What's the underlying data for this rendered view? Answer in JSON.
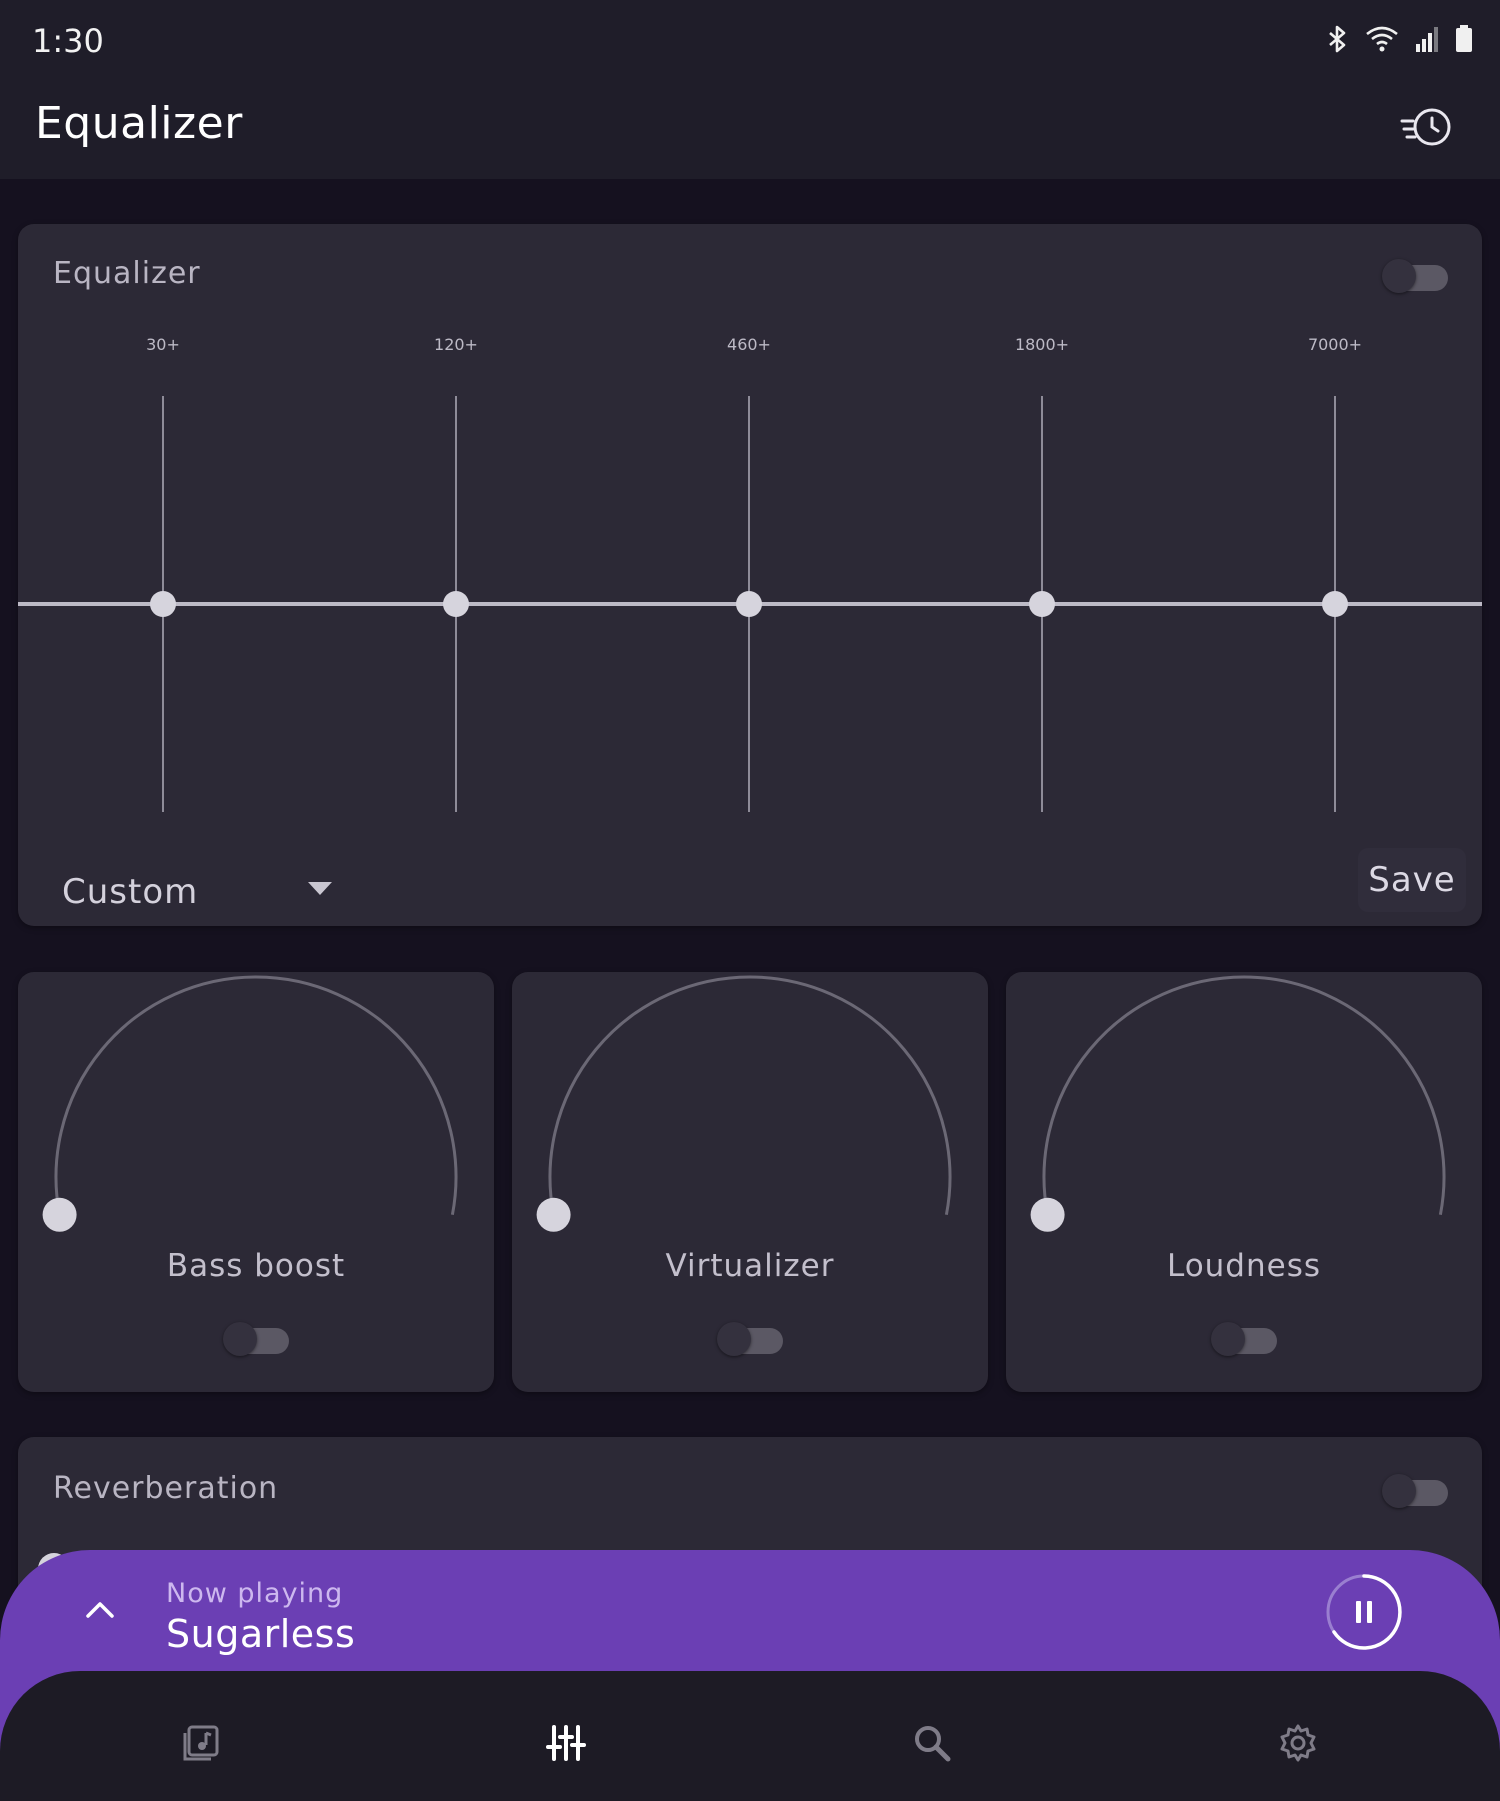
{
  "status_bar": {
    "time": "1:30",
    "icons": [
      "bluetooth-icon",
      "wifi-icon",
      "signal-icon",
      "battery-icon"
    ]
  },
  "app_bar": {
    "title": "Equalizer",
    "action_icon": "sleep-timer-icon"
  },
  "equalizer": {
    "label": "Equalizer",
    "enabled": false,
    "bands": [
      {
        "label": "30+",
        "level": 0.5
      },
      {
        "label": "120+",
        "level": 0.5
      },
      {
        "label": "460+",
        "level": 0.5
      },
      {
        "label": "1800+",
        "level": 0.5
      },
      {
        "label": "7000+",
        "level": 0.5
      }
    ],
    "preset": "Custom",
    "save_label": "Save"
  },
  "effects": [
    {
      "label": "Bass boost",
      "level": 0,
      "enabled": false
    },
    {
      "label": "Virtualizer",
      "level": 0,
      "enabled": false
    },
    {
      "label": "Loudness",
      "level": 0,
      "enabled": false
    }
  ],
  "reverberation": {
    "label": "Reverberation",
    "enabled": false
  },
  "now_playing": {
    "caption": "Now playing",
    "title": "Sugarless",
    "state": "playing"
  },
  "bottom_nav": {
    "items": [
      "library-icon",
      "equalizer-icon",
      "search-icon",
      "settings-icon"
    ],
    "active": "equalizer-icon"
  },
  "colors": {
    "accent": "#6b3fb4",
    "background": "#15111f",
    "card": "#2c2936"
  }
}
